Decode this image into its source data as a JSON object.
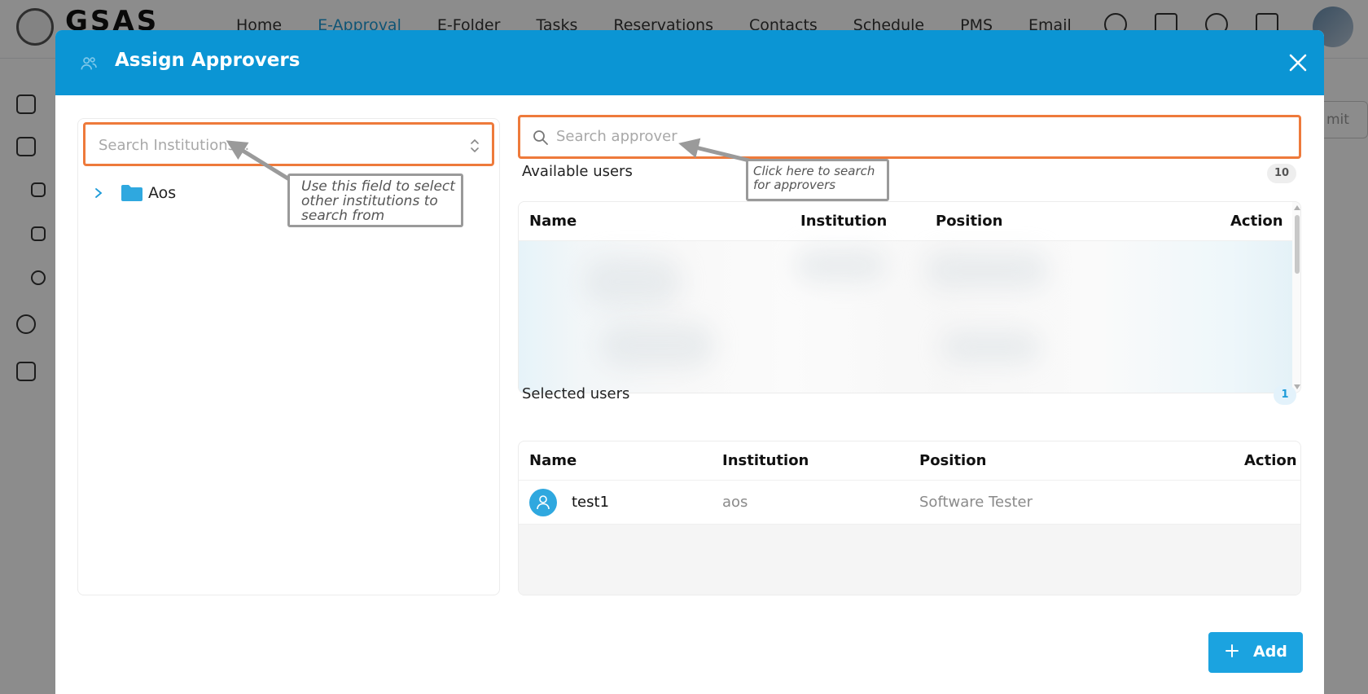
{
  "app": {
    "logo_text": "GSAS",
    "nav": [
      "Home",
      "E-Approval",
      "E-Folder",
      "Tasks",
      "Reservations",
      "Contacts",
      "Schedule",
      "PMS",
      "Email"
    ],
    "background_button": "mit"
  },
  "modal": {
    "title": "Assign Approvers",
    "header_color": "#0b95d4",
    "accent_color": "#1ba3e0",
    "highlight_color": "#ee7a3b"
  },
  "institutions": {
    "placeholder": "Search Institutions...",
    "tree": [
      {
        "label": "Aos",
        "expanded": false
      }
    ]
  },
  "search": {
    "placeholder": "Search approver"
  },
  "callouts": {
    "institution_hint": "Use this field to select other institutions to search from",
    "search_hint": "Click here to search for approvers"
  },
  "available": {
    "title": "Available users",
    "count": "10",
    "columns": [
      "Name",
      "Institution",
      "Position",
      "Action"
    ]
  },
  "selected": {
    "title": "Selected users",
    "count": "1",
    "columns": [
      "Name",
      "Institution",
      "Position",
      "Action"
    ],
    "rows": [
      {
        "name": "test1",
        "institution": "aos",
        "position": "Software Tester"
      }
    ]
  },
  "actions": {
    "add_label": "Add"
  }
}
